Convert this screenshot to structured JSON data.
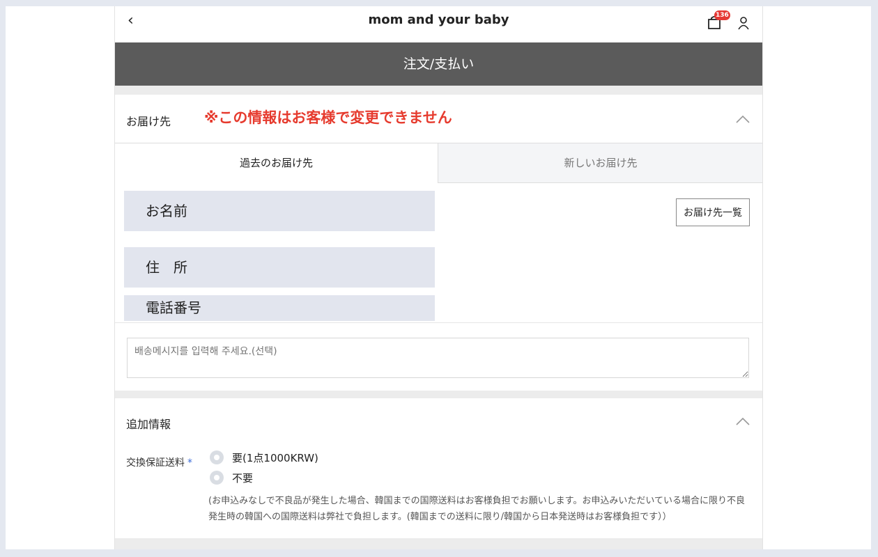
{
  "header": {
    "back_icon": "chevron-left-icon",
    "brand": "mom and your baby",
    "cart_icon": "shopping-bag-icon",
    "cart_count": "136",
    "user_icon": "user-icon"
  },
  "page_title": "注文/支払い",
  "shipping": {
    "label": "お届け先",
    "warning": "※この情報はお客様で変更できません",
    "tabs": [
      "過去のお届け先",
      "新しいお届け先"
    ],
    "active_tab": 0,
    "name_field": "お名前",
    "address_field": "住　所",
    "phone_field": "電話番号",
    "address_list_button": "お届け先一覧",
    "message_placeholder": "배송메시지를 입력해 주세요.(선택)"
  },
  "additional": {
    "label": "追加情報",
    "option_label": "交換保証送料",
    "required_mark": "*",
    "options": [
      "要(1点1000KRW)",
      "不要"
    ],
    "note_line1": "(お申込みなしで不良品が発生した場合、韓国までの国際送料はお客様負担でお願いします。お申込みいただいている場合に限り不良",
    "note_line2": "発生時の韓国への国際送料は弊社で負担します。(韓国までの送料に限り/韓国から日本発送時はお客様負担です））"
  },
  "colors": {
    "title_bar": "#5b5b5b",
    "warning": "#e63b2e",
    "field_bg": "#e2e5ee",
    "badge": "#e53935",
    "required": "#3a6bd8"
  }
}
